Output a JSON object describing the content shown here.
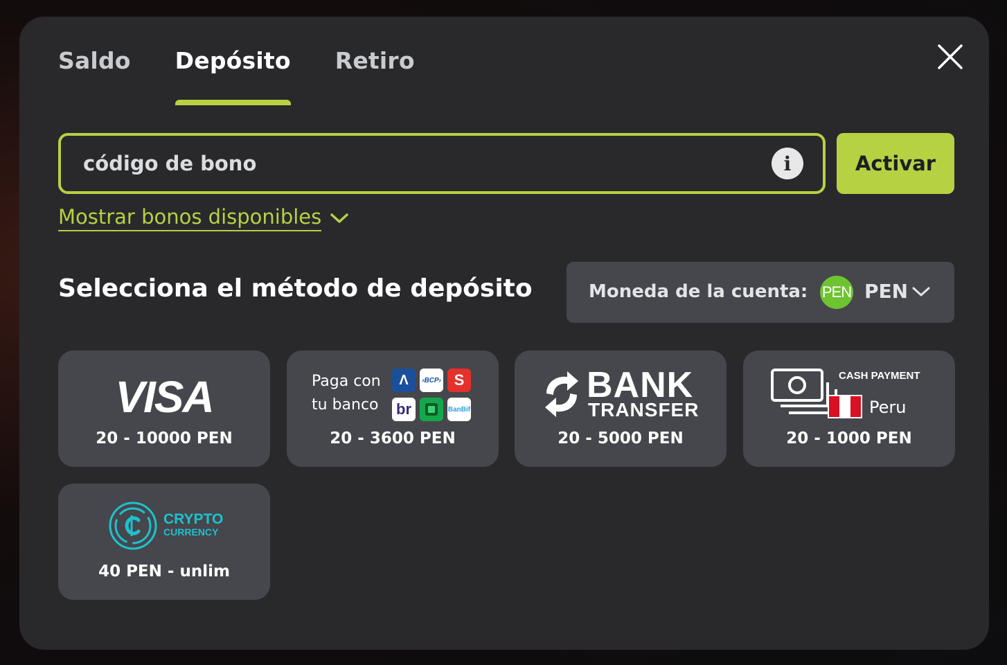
{
  "tabs": [
    {
      "label": "Saldo",
      "active": false
    },
    {
      "label": "Depósito",
      "active": true
    },
    {
      "label": "Retiro",
      "active": false
    }
  ],
  "bonus": {
    "placeholder": "código de bono",
    "activate_label": "Activar",
    "show_available_label": "Mostrar bonos disponibles"
  },
  "section_title": "Selecciona el método de depósito",
  "currency": {
    "label": "Moneda de la cuenta:",
    "badge": "PEN",
    "code": "PEN"
  },
  "methods": [
    {
      "name": "VISA",
      "logo_text": "VISA",
      "range": "20 - 10000 PEN"
    },
    {
      "name": "Paga con tu banco",
      "line1": "Paga con",
      "line2": "tu banco",
      "bank_tiles": [
        "Λ",
        "›BCP›",
        "S",
        "br",
        "",
        "BanBif"
      ],
      "range": "20 - 3600 PEN"
    },
    {
      "name": "Bank Transfer",
      "logo_line1": "BANK",
      "logo_line2": "TRANSFER",
      "range": "20 - 5000 PEN"
    },
    {
      "name": "Cash Payment Peru",
      "logo_line1": "CASH PAYMENT",
      "logo_line2": "Peru",
      "range": "20 - 1000 PEN"
    },
    {
      "name": "Crypto Currency",
      "logo_line1": "CRYPTO",
      "logo_line2": "CURRENCY",
      "range": "40 PEN - unlim"
    }
  ],
  "colors": {
    "accent": "#b6d243",
    "modal_bg": "#29292c",
    "card_bg": "#45474c",
    "crypto": "#1ec2cf",
    "pen_badge": "#6ec331"
  }
}
